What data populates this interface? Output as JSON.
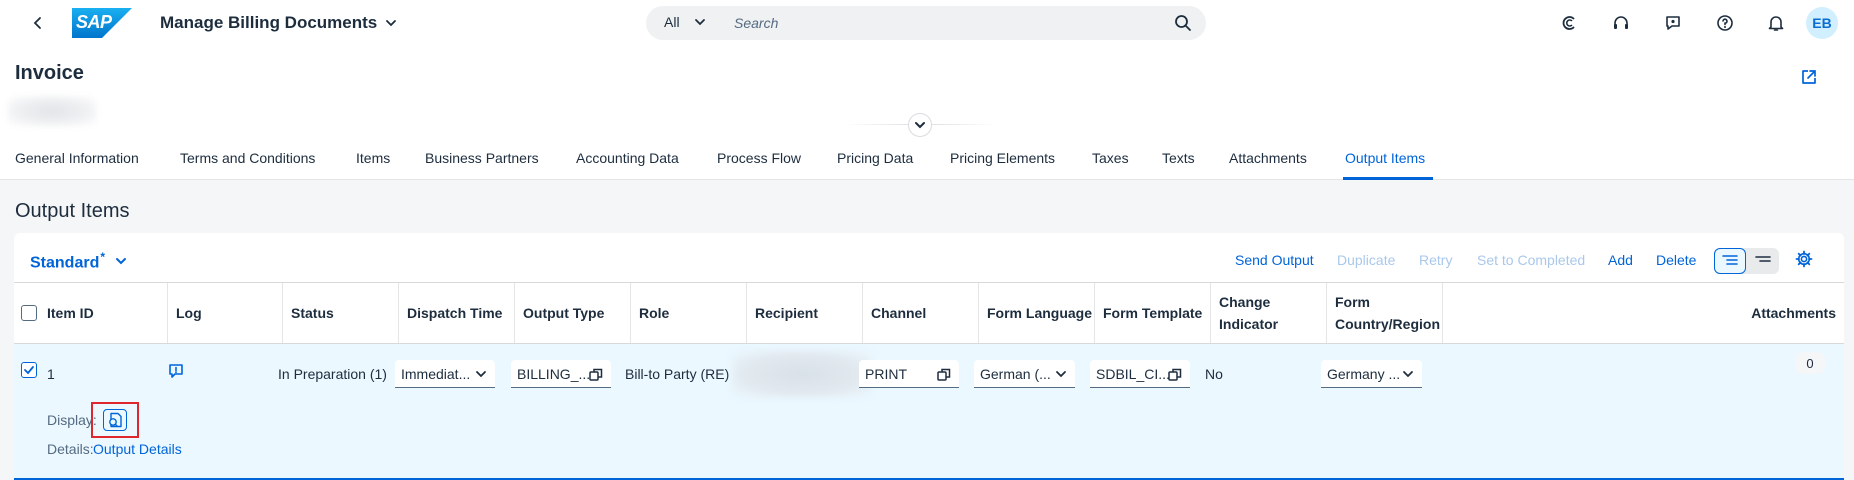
{
  "shell": {
    "logo_text": "SAP",
    "app_title": "Manage Billing Documents",
    "search_scope": "All",
    "search_placeholder": "Search",
    "avatar_initials": "EB"
  },
  "header": {
    "title": "Invoice"
  },
  "tabs": [
    {
      "label": "General Information"
    },
    {
      "label": "Terms and Conditions"
    },
    {
      "label": "Items"
    },
    {
      "label": "Business Partners"
    },
    {
      "label": "Accounting Data"
    },
    {
      "label": "Process Flow"
    },
    {
      "label": "Pricing Data"
    },
    {
      "label": "Pricing Elements"
    },
    {
      "label": "Taxes"
    },
    {
      "label": "Texts"
    },
    {
      "label": "Attachments"
    },
    {
      "label": "Output Items",
      "active": true
    }
  ],
  "section": {
    "title": "Output Items"
  },
  "toolbar": {
    "variant": "Standard",
    "variant_marker": "*",
    "send_output": "Send Output",
    "duplicate": "Duplicate",
    "retry": "Retry",
    "set_to_completed": "Set to Completed",
    "add": "Add",
    "delete": "Delete"
  },
  "table": {
    "columns": [
      "Item ID",
      "Log",
      "Status",
      "Dispatch Time",
      "Output Type",
      "Role",
      "Recipient",
      "Channel",
      "Form Language",
      "Form Template",
      "Change Indicator",
      "Form Country/Region",
      "Attachments"
    ],
    "row": {
      "item_id": "1",
      "status": "In Preparation (1)",
      "dispatch_time": "Immediat...",
      "output_type": "BILLING_...",
      "role": "Bill-to Party (RE)",
      "channel": "PRINT",
      "form_language": "German (...",
      "form_template": "SDBIL_CI...",
      "change_indicator": "No",
      "form_country": "Germany ...",
      "attachments": "0",
      "display_label": "Display:",
      "details_label": "Details:",
      "details_link": "Output Details"
    }
  },
  "colors": {
    "brand_blue": "#0064d9",
    "selected_row": "#ebf8ff",
    "highlight_red": "#e0262d",
    "disabled_text": "#a9c8ec"
  }
}
